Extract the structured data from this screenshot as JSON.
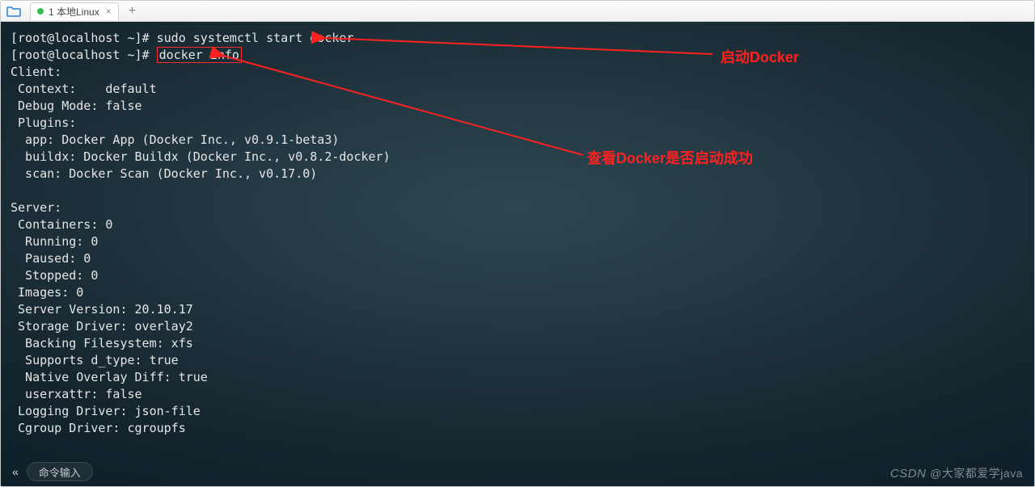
{
  "tabbar": {
    "tab_label": "1 本地Linux",
    "close_glyph": "×",
    "add_glyph": "+"
  },
  "terminal": {
    "prompt1_pre": "[root@localhost ~]# ",
    "cmd1": "sudo systemctl start docker",
    "prompt2_pre": "[root@localhost ~]# ",
    "cmd2": "docker info",
    "lines": [
      "Client:",
      " Context:    default",
      " Debug Mode: false",
      " Plugins:",
      "  app: Docker App (Docker Inc., v0.9.1-beta3)",
      "  buildx: Docker Buildx (Docker Inc., v0.8.2-docker)",
      "  scan: Docker Scan (Docker Inc., v0.17.0)",
      "",
      "Server:",
      " Containers: 0",
      "  Running: 0",
      "  Paused: 0",
      "  Stopped: 0",
      " Images: 0",
      " Server Version: 20.10.17",
      " Storage Driver: overlay2",
      "  Backing Filesystem: xfs",
      "  Supports d_type: true",
      "  Native Overlay Diff: true",
      "  userxattr: false",
      " Logging Driver: json-file",
      " Cgroup Driver: cgroupfs"
    ]
  },
  "annotations": {
    "anno1": "启动Docker",
    "anno2": "查看Docker是否启动成功"
  },
  "statusbar": {
    "chev": "«",
    "hint": "命令输入"
  },
  "watermark": {
    "site": "CSDN",
    "author": "@大家都爱学java"
  },
  "colors": {
    "accent_red": "#ff2020"
  }
}
